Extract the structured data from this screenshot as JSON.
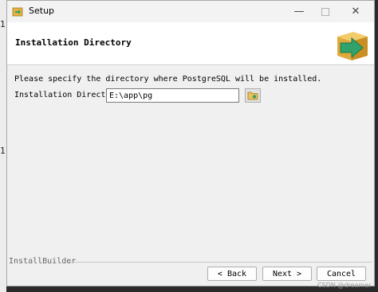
{
  "background": {
    "left_char_1": "1",
    "left_char_2": "1"
  },
  "window": {
    "title": "Setup",
    "controls": {
      "minimize": "—",
      "maximize": "☐",
      "close": "✕"
    }
  },
  "header": {
    "title": "Installation Directory"
  },
  "content": {
    "description": "Please specify the directory where PostgreSQL will be installed.",
    "directory_label": "Installation Directory",
    "directory_value": "E:\\app\\pg"
  },
  "footer": {
    "brand": "InstallBuilder",
    "back_label": "< Back",
    "next_label": "Next >",
    "cancel_label": "Cancel"
  },
  "watermark": "CSDN @dreamer",
  "colors": {
    "logo_box": "#e6b340",
    "logo_arrow": "#2fa36b",
    "window_bg": "#f0f0f0"
  }
}
